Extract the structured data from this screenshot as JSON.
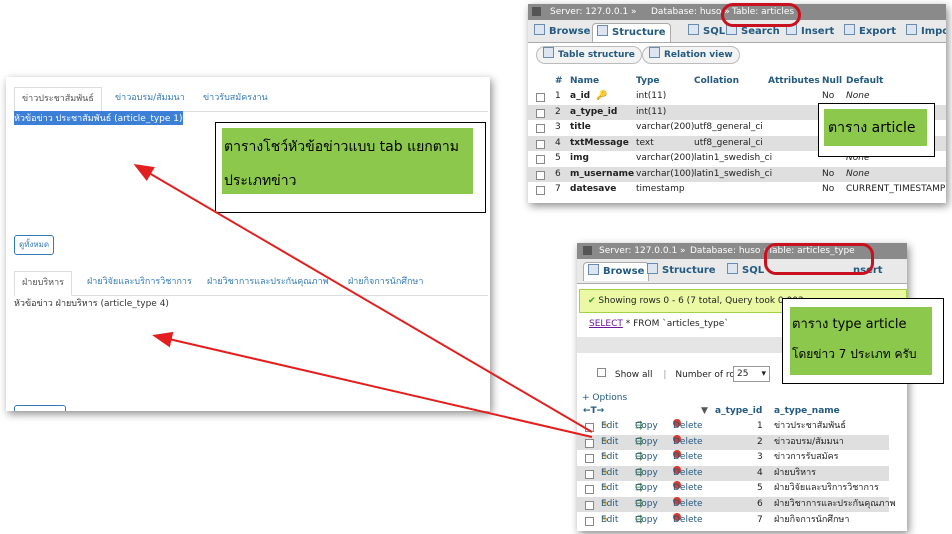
{
  "left_panel": {
    "tabs1": [
      "ข่าวประชาสัมพันธ์",
      "ข่าวอบรม/สัมมนา",
      "ข่าวรับสมัครงาน"
    ],
    "text1": "หัวข้อข่าว ประชาสัมพันธ์ (article_type 1)",
    "see_all": "ดูทั้งหมด",
    "tabs2": [
      "ฝ่ายบริหาร",
      "ฝ่ายวิจัยและบริการวิชาการ",
      "ฝ่ายวิชาการและประกันคุณภาพ",
      "ฝ่ายกิจการนักศึกษา"
    ],
    "text2": "หัวข้อข่าว ฝ่ายบริหาร (article_type 4)"
  },
  "callouts": {
    "left": {
      "line1": "ตารางโชว์หัวข้อข่าวแบบ tab แยกตาม",
      "line2": "ประเภทข่าว"
    },
    "articles": {
      "line1": "ตาราง article"
    },
    "types": {
      "line1": "ตาราง type article",
      "line2": "โดยข่าว 7 ประเภท  ครับ"
    }
  },
  "pma_structure": {
    "crumb": {
      "server": "Server: 127.0.0.1 »",
      "database": "Database: huso »",
      "table": "Table: articles"
    },
    "tabs": [
      "Browse",
      "Structure",
      "SQL",
      "Search",
      "Insert",
      "Export",
      "Impo"
    ],
    "subtabs": [
      "Table structure",
      "Relation view"
    ],
    "headers": [
      "#",
      "Name",
      "Type",
      "Collation",
      "Attributes",
      "Null",
      "Default"
    ],
    "rows": [
      {
        "n": "1",
        "name": "a_id",
        "type": "int(11)",
        "coll": "",
        "null": "No",
        "def": "None"
      },
      {
        "n": "2",
        "name": "a_type_id",
        "type": "int(11)",
        "coll": "",
        "null": "",
        "def": ""
      },
      {
        "n": "3",
        "name": "title",
        "type": "varchar(200)",
        "coll": "utf8_general_ci",
        "null": "",
        "def": ""
      },
      {
        "n": "4",
        "name": "txtMessage",
        "type": "text",
        "coll": "utf8_general_ci",
        "null": "",
        "def": ""
      },
      {
        "n": "5",
        "name": "img",
        "type": "varchar(200)",
        "coll": "latin1_swedish_ci",
        "null": "",
        "def": "None"
      },
      {
        "n": "6",
        "name": "m_username",
        "type": "varchar(100)",
        "coll": "latin1_swedish_ci",
        "null": "No",
        "def": "None"
      },
      {
        "n": "7",
        "name": "datesave",
        "type": "timestamp",
        "coll": "",
        "null": "No",
        "def": "CURRENT_TIMESTAMP"
      }
    ]
  },
  "pma_types": {
    "crumb": {
      "server": "Server: 127.0.0.1 »",
      "database": "Database: huso »",
      "table": "Table: articles_type"
    },
    "tabs": [
      "Browse",
      "Structure",
      "SQL",
      "nsert"
    ],
    "success": "Showing rows 0 - 6 (7 total, Query took 0.003",
    "sql_kw": "SELECT",
    "sql_rest": " * FROM `articles_type`",
    "show_all": "Show all",
    "num_rows_label": "Number of rows:",
    "num_rows_value": "25",
    "options": "+ Options",
    "headers": [
      "a_type_id",
      "a_type_name"
    ],
    "actions": {
      "edit": "Edit",
      "copy": "Copy",
      "delete": "Delete"
    },
    "rows": [
      {
        "id": "1",
        "name": "ข่าวประชาสัมพันธ์"
      },
      {
        "id": "2",
        "name": "ข่าวอบรม/สัมมนา"
      },
      {
        "id": "3",
        "name": "ข่าวการรับสมัคร"
      },
      {
        "id": "4",
        "name": "ฝ่ายบริหาร"
      },
      {
        "id": "5",
        "name": "ฝ่ายวิจัยและบริการวิชาการ"
      },
      {
        "id": "6",
        "name": "ฝ่ายวิชาการและประกันคุณภาพ"
      },
      {
        "id": "7",
        "name": "ฝ่ายกิจการนักศึกษา"
      }
    ]
  },
  "colors": {
    "arrow": "#e31e1e",
    "callout_fill": "#8cc84b",
    "link": "#337ab7"
  }
}
